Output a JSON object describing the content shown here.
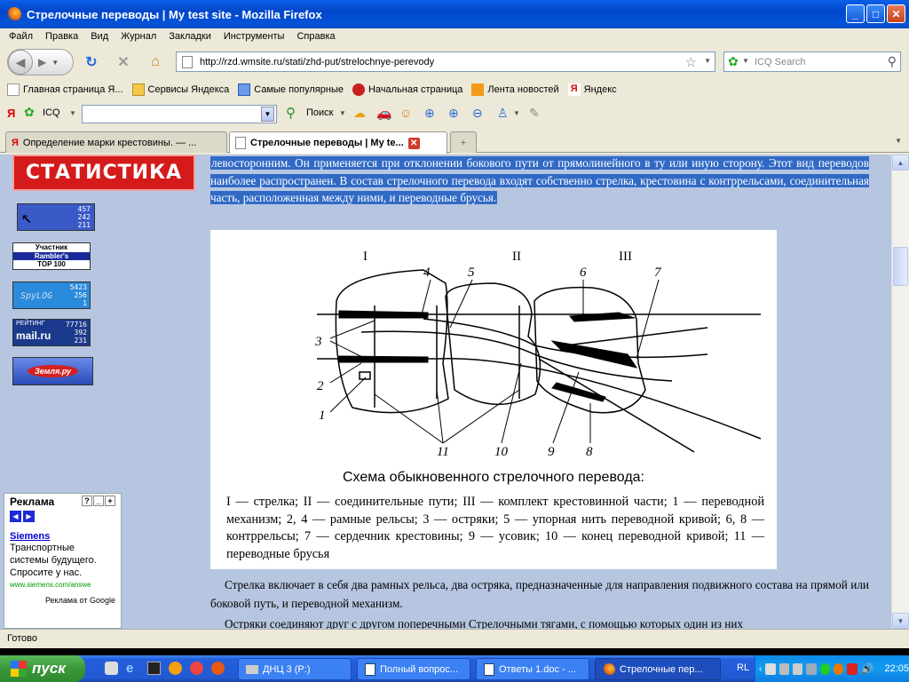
{
  "window": {
    "title": "Стрелочные переводы | My test site - Mozilla Firefox"
  },
  "menu": [
    "Файл",
    "Правка",
    "Вид",
    "Журнал",
    "Закладки",
    "Инструменты",
    "Справка"
  ],
  "nav": {
    "url": "http://rzd.wmsite.ru/stati/zhd-put/strelochnye-perevody",
    "search_placeholder": "ICQ Search"
  },
  "bookmarks": [
    "Главная страница Я...",
    "Сервисы Яндекса",
    "Самые популярные",
    "Начальная страница",
    "Лента новостей",
    "Яндекс"
  ],
  "yandex_toolbar": {
    "icq": "ICQ",
    "search": "Поиск"
  },
  "tabs": [
    {
      "label": "Определение марки крестовины. — ...",
      "active": false
    },
    {
      "label": "Стрелочные переводы | My te...",
      "active": true
    }
  ],
  "sidebar": {
    "banner": "СТАТИСТИКА",
    "counter1": [
      "457",
      "242",
      "211"
    ],
    "rambler": [
      "Участник",
      "Rambler's",
      "TOP 100"
    ],
    "spylog": [
      "5423",
      "256",
      "1"
    ],
    "spylog_brand": "SpyLOG",
    "mailru": {
      "label": "РЕЙТИНГ",
      "brand": "mail.ru",
      "values": [
        "77716",
        "392",
        "231"
      ]
    },
    "zemlyaru": "Земля.ру"
  },
  "ad": {
    "title": "Реклама",
    "link": "Siemens",
    "text": "Транспортные системы будущего. Спросите у нас.",
    "url": "www.siemens.com/answe",
    "footer": "Реклама от Google"
  },
  "article": {
    "intro": "левосторонним. Он применяется при отклонении бокового пути от прямолинейного в ту или иную сторону. Этот вид переводов наиболее распространен. В состав стрелочного перевода входят собственно стрелка, крестовина с контррельсами, соединительная часть, расположенная между ними, и переводные брусья.",
    "figure_title": "Схема обыкновенного стрелочного перевода:",
    "figure_caption": "I — стрелка; II — соединительные пути; III — комплект крестовинной части; 1 — переводной механизм; 2, 4 — рамные рельсы; 3 — остряки; 5 — упорная нить переводной кривой; 6, 8 — контррельсы; 7 — сердечник крестовины; 9 — усовик; 10 — конец переводной кривой; 11 — переводные брусья",
    "para1": "Стрелка включает в себя два рамных рельса, два остряка, предназначенные для направления подвижного состава на прямой или боковой путь, и переводной механизм.",
    "para2": "Остряки соединяют друг с другом поперечными Стрелочными тягами, с помощью которых один из них",
    "figure_labels": {
      "I": "I",
      "II": "II",
      "III": "III",
      "n1": "1",
      "n2": "2",
      "n3": "3",
      "n4": "4",
      "n5": "5",
      "n6": "6",
      "n7": "7",
      "n8": "8",
      "n9": "9",
      "n10": "10",
      "n11": "11"
    }
  },
  "status": "Готово",
  "taskbar": {
    "start": "пуск",
    "items": [
      "ДНЦ 3 (P:)",
      "Полный вопрос...",
      "Ответы 1.doc - ...",
      "Стрелочные пер..."
    ],
    "lang": "RL",
    "time": "22:05"
  }
}
